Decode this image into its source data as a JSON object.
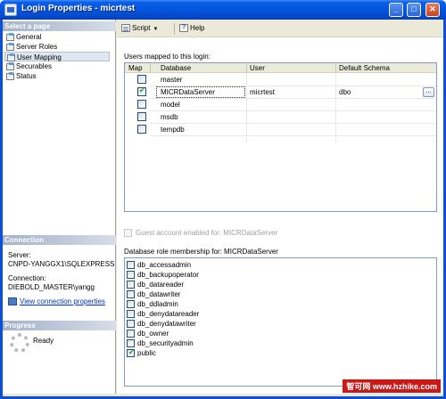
{
  "window": {
    "title": "Login Properties - micrtest"
  },
  "sidebar": {
    "select_page_heading": "Select a page",
    "pages": [
      {
        "label": "General",
        "selected": false
      },
      {
        "label": "Server Roles",
        "selected": false
      },
      {
        "label": "User Mapping",
        "selected": true
      },
      {
        "label": "Securables",
        "selected": false
      },
      {
        "label": "Status",
        "selected": false
      }
    ],
    "connection_heading": "Connection",
    "server_label": "Server:",
    "server_value": "CNPD-YANGGX1\\SQLEXPRESS",
    "connection_label": "Connection:",
    "connection_value": "DIEBOLD_MASTER\\yangg",
    "view_connection_link": "View connection properties",
    "progress_heading": "Progress",
    "progress_status": "Ready"
  },
  "toolbar": {
    "script_label": "Script",
    "help_label": "Help"
  },
  "mapping": {
    "caption": "Users mapped to this login:",
    "columns": [
      "Map",
      "Database",
      "User",
      "Default Schema"
    ],
    "rows": [
      {
        "map": false,
        "database": "master",
        "user": "",
        "schema": ""
      },
      {
        "map": true,
        "database": "MICRDataServer",
        "user": "micrtest",
        "schema": "dbo"
      },
      {
        "map": false,
        "database": "model",
        "user": "",
        "schema": ""
      },
      {
        "map": false,
        "database": "msdb",
        "user": "",
        "schema": ""
      },
      {
        "map": false,
        "database": "tempdb",
        "user": "",
        "schema": ""
      }
    ],
    "ellipsis_label": "..."
  },
  "guest": {
    "label": "Guest account enabled for: MICRDataServer",
    "enabled": false
  },
  "roles": {
    "caption": "Database role membership for: MICRDataServer",
    "items": [
      {
        "label": "db_accessadmin",
        "checked": false
      },
      {
        "label": "db_backupoperator",
        "checked": false
      },
      {
        "label": "db_datareader",
        "checked": false
      },
      {
        "label": "db_datawriter",
        "checked": false
      },
      {
        "label": "db_ddladmin",
        "checked": false
      },
      {
        "label": "db_denydatareader",
        "checked": false
      },
      {
        "label": "db_denydatawriter",
        "checked": false
      },
      {
        "label": "db_owner",
        "checked": false
      },
      {
        "label": "db_securityadmin",
        "checked": false
      },
      {
        "label": "public",
        "checked": true
      }
    ]
  },
  "watermark": {
    "text": "智可网 www.hzhike.com"
  }
}
